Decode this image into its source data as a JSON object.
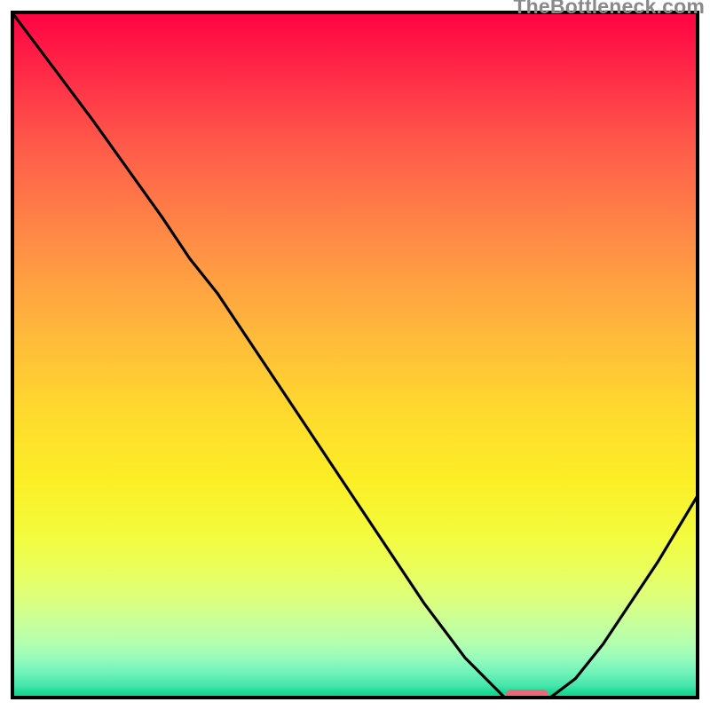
{
  "watermark": "TheBottleneck.com",
  "chart_data": {
    "type": "line",
    "title": "",
    "xlabel": "",
    "ylabel": "",
    "xlim": [
      0,
      100
    ],
    "ylim": [
      0,
      100
    ],
    "grid": false,
    "background": "vertical red-to-green gradient",
    "series": [
      {
        "name": "bottleneck-curve",
        "x": [
          0,
          6,
          12,
          17,
          22,
          26,
          30,
          36,
          42,
          48,
          54,
          60,
          66,
          70,
          72,
          75,
          78,
          82,
          86,
          90,
          94,
          100
        ],
        "y": [
          100,
          92,
          84,
          77,
          70,
          64,
          59,
          50,
          41,
          32,
          23,
          14,
          6,
          2,
          0,
          0,
          0,
          3,
          8,
          14,
          20,
          30
        ]
      }
    ],
    "marker": {
      "name": "optimal-point",
      "x": 75,
      "y": 0,
      "shape": "rounded-bar",
      "color": "#e96979"
    }
  }
}
